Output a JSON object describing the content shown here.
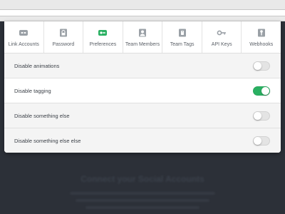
{
  "colors": {
    "accent_green": "#2ab062",
    "background_dark": "#2c3038",
    "panel_bg": "#ffffff"
  },
  "tabs": [
    {
      "label": "Link Accounts",
      "icon": "link-accounts-icon",
      "selected": false
    },
    {
      "label": "Password",
      "icon": "lock-icon",
      "selected": false
    },
    {
      "label": "Preferences",
      "icon": "preferences-icon",
      "selected": true
    },
    {
      "label": "Team Members",
      "icon": "user-icon",
      "selected": false
    },
    {
      "label": "Team Tags",
      "icon": "tag-icon",
      "selected": false
    },
    {
      "label": "API Keys",
      "icon": "key-icon",
      "selected": false
    },
    {
      "label": "Webhooks",
      "icon": "webhook-icon",
      "selected": false
    }
  ],
  "settings": [
    {
      "label": "Disable animations",
      "enabled": false
    },
    {
      "label": "Disable tagging",
      "enabled": true
    },
    {
      "label": "Disable something else",
      "enabled": false
    },
    {
      "label": "Disable something else else",
      "enabled": false
    }
  ],
  "background": {
    "heading": "Connect your Social Accounts"
  }
}
